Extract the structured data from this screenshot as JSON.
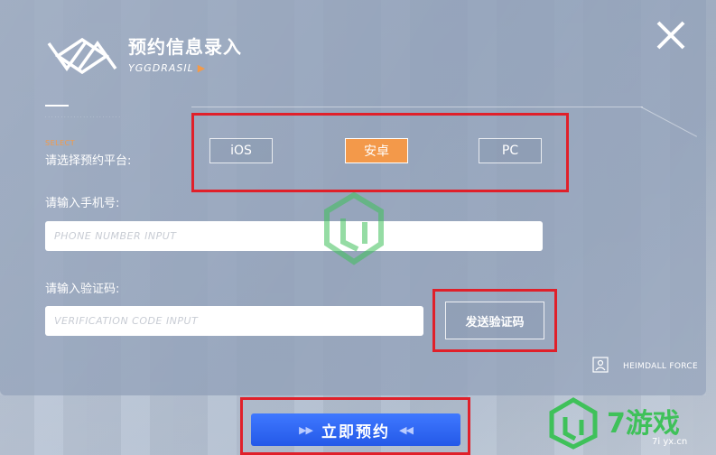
{
  "header": {
    "title": "预约信息录入",
    "subtitle": "YGGDRASIL",
    "subtitle_arrow": "▶"
  },
  "platform": {
    "select_tag": "SELECT",
    "label": "请选择预约平台:",
    "options": [
      "iOS",
      "安卓",
      "PC"
    ],
    "selected": "安卓"
  },
  "phone": {
    "label": "请输入手机号:",
    "placeholder": "PHONE NUMBER INPUT",
    "value": ""
  },
  "verification": {
    "label": "请输入验证码:",
    "placeholder": "VERIFICATION CODE INPUT",
    "value": "",
    "send_button": "发送验证码"
  },
  "footer": {
    "brand": "HEIMDALL FORCE"
  },
  "submit": {
    "label": "立即预约",
    "left_chevrons": "▶▶",
    "right_chevrons": "◀◀"
  },
  "site_brand": {
    "name": "7游戏",
    "url": "7i yx.cn"
  },
  "colors": {
    "accent_orange": "#f3994a",
    "submit_blue": "#2f66f0",
    "highlight_red": "#e0202a",
    "brand_green": "#3fc15a"
  }
}
